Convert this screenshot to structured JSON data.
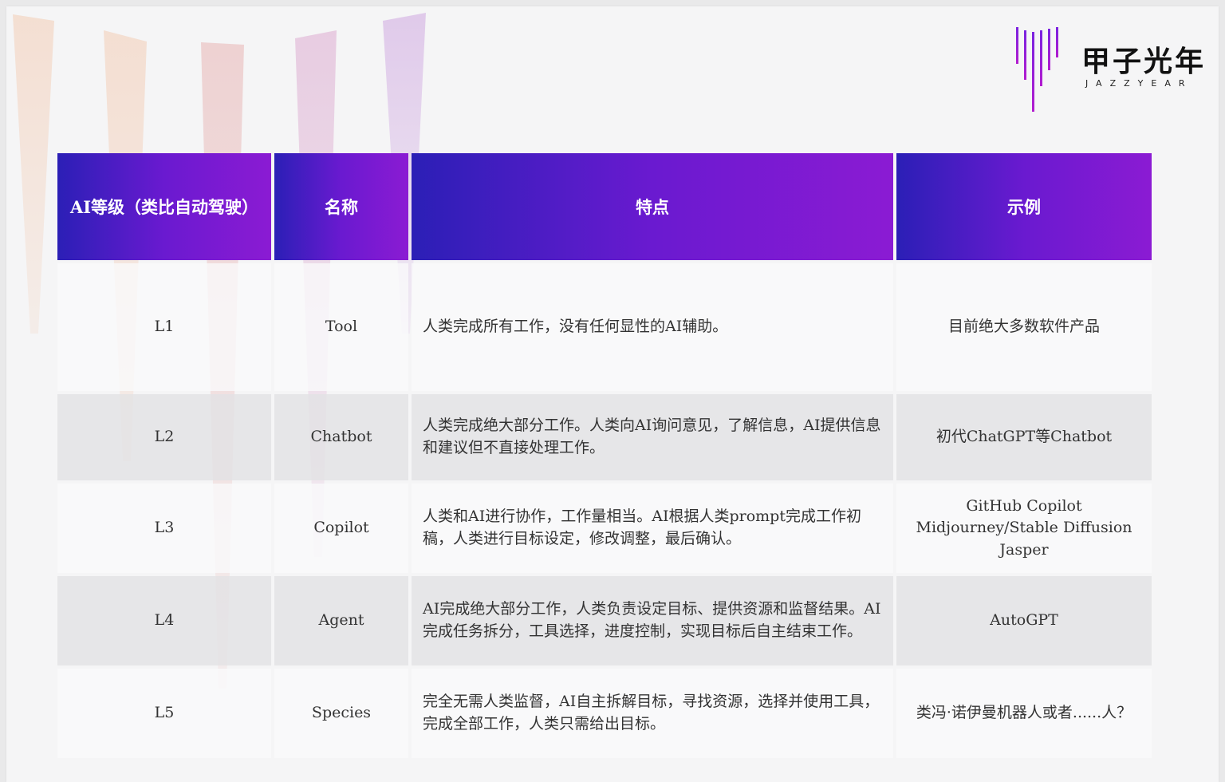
{
  "logo": {
    "name": "甲子光年",
    "sub": "JAZZYEAR"
  },
  "table": {
    "headers": [
      "AI等级（类比自动驾驶）",
      "名称",
      "特点",
      "示例"
    ],
    "rows": [
      {
        "level": "L1",
        "name": "Tool",
        "feature": "人类完成所有工作，没有任何显性的AI辅助。",
        "example": "目前绝大多数软件产品"
      },
      {
        "level": "L2",
        "name": "Chatbot",
        "feature": "人类完成绝大部分工作。人类向AI询问意见，了解信息，AI提供信息和建议但不直接处理工作。",
        "example": "初代ChatGPT等Chatbot"
      },
      {
        "level": "L3",
        "name": "Copilot",
        "feature": "人类和AI进行协作，工作量相当。AI根据人类prompt完成工作初稿，人类进行目标设定，修改调整，最后确认。",
        "example": "GitHub Copilot\nMidjourney/Stable Diffusion\nJasper"
      },
      {
        "level": "L4",
        "name": "Agent",
        "feature": "AI完成绝大部分工作，人类负责设定目标、提供资源和监督结果。AI完成任务拆分，工具选择，进度控制，实现目标后自主结束工作。",
        "example": "AutoGPT"
      },
      {
        "level": "L5",
        "name": "Species",
        "feature": "完全无需人类监督，AI自主拆解目标，寻找资源，选择并使用工具，完成全部工作，人类只需给出目标。",
        "example": "类冯·诺伊曼机器人或者......人？"
      }
    ]
  },
  "colors": {
    "header_start": "#2b1fb6",
    "header_end": "#8b1bd3",
    "logo_accent": "#8a1fd6"
  }
}
